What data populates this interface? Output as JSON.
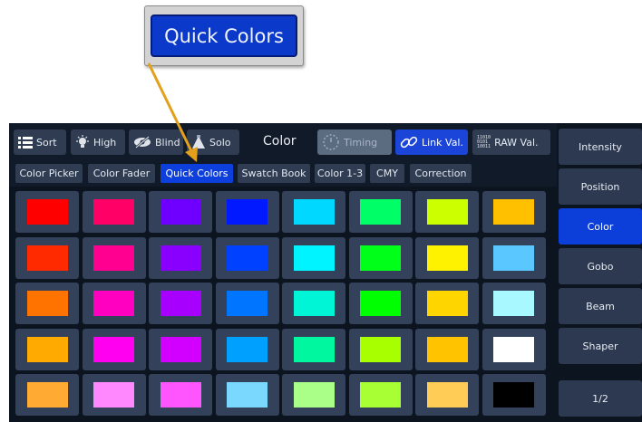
{
  "callout": {
    "label": "Quick Colors"
  },
  "toolbar": {
    "sort": "Sort",
    "high": "High",
    "blind": "Blind",
    "solo": "Solo",
    "title": "Color",
    "timing": "Timing",
    "link_val": "Link Val.",
    "raw_val": "RAW Val.",
    "raw_icon_text": "11010\n0101\n10011"
  },
  "tabs": [
    "Color Picker",
    "Color Fader",
    "Quick Colors",
    "Swatch Book",
    "Color 1-3",
    "CMY",
    "Correction"
  ],
  "active_tab": "Quick Colors",
  "swatches": [
    [
      "#ff0000",
      "#ff0066",
      "#6f00ff",
      "#0019ff",
      "#00d8ff",
      "#00ff66",
      "#ccff00",
      "#ffc000"
    ],
    [
      "#ff2a00",
      "#ff0090",
      "#8a00ff",
      "#0040ff",
      "#00f4ff",
      "#00ff19",
      "#fff200",
      "#5ac8ff"
    ],
    [
      "#ff7300",
      "#ff00c0",
      "#a800ff",
      "#0075ff",
      "#00f5d7",
      "#00ff00",
      "#ffd500",
      "#a8f8ff"
    ],
    [
      "#ffaa00",
      "#ff00f0",
      "#d200ff",
      "#00a0ff",
      "#00f7a0",
      "#a8ff00",
      "#ffc300",
      "#ffffff"
    ],
    [
      "#ffaa33",
      "#ff88ff",
      "#ff55ff",
      "#7ad8ff",
      "#aaff88",
      "#a8ff33",
      "#ffcc55",
      "#000000"
    ]
  ],
  "sidebar": {
    "items": [
      "Intensity",
      "Position",
      "Color",
      "Gobo",
      "Beam",
      "Shaper"
    ],
    "active": "Color",
    "page": "1/2"
  }
}
